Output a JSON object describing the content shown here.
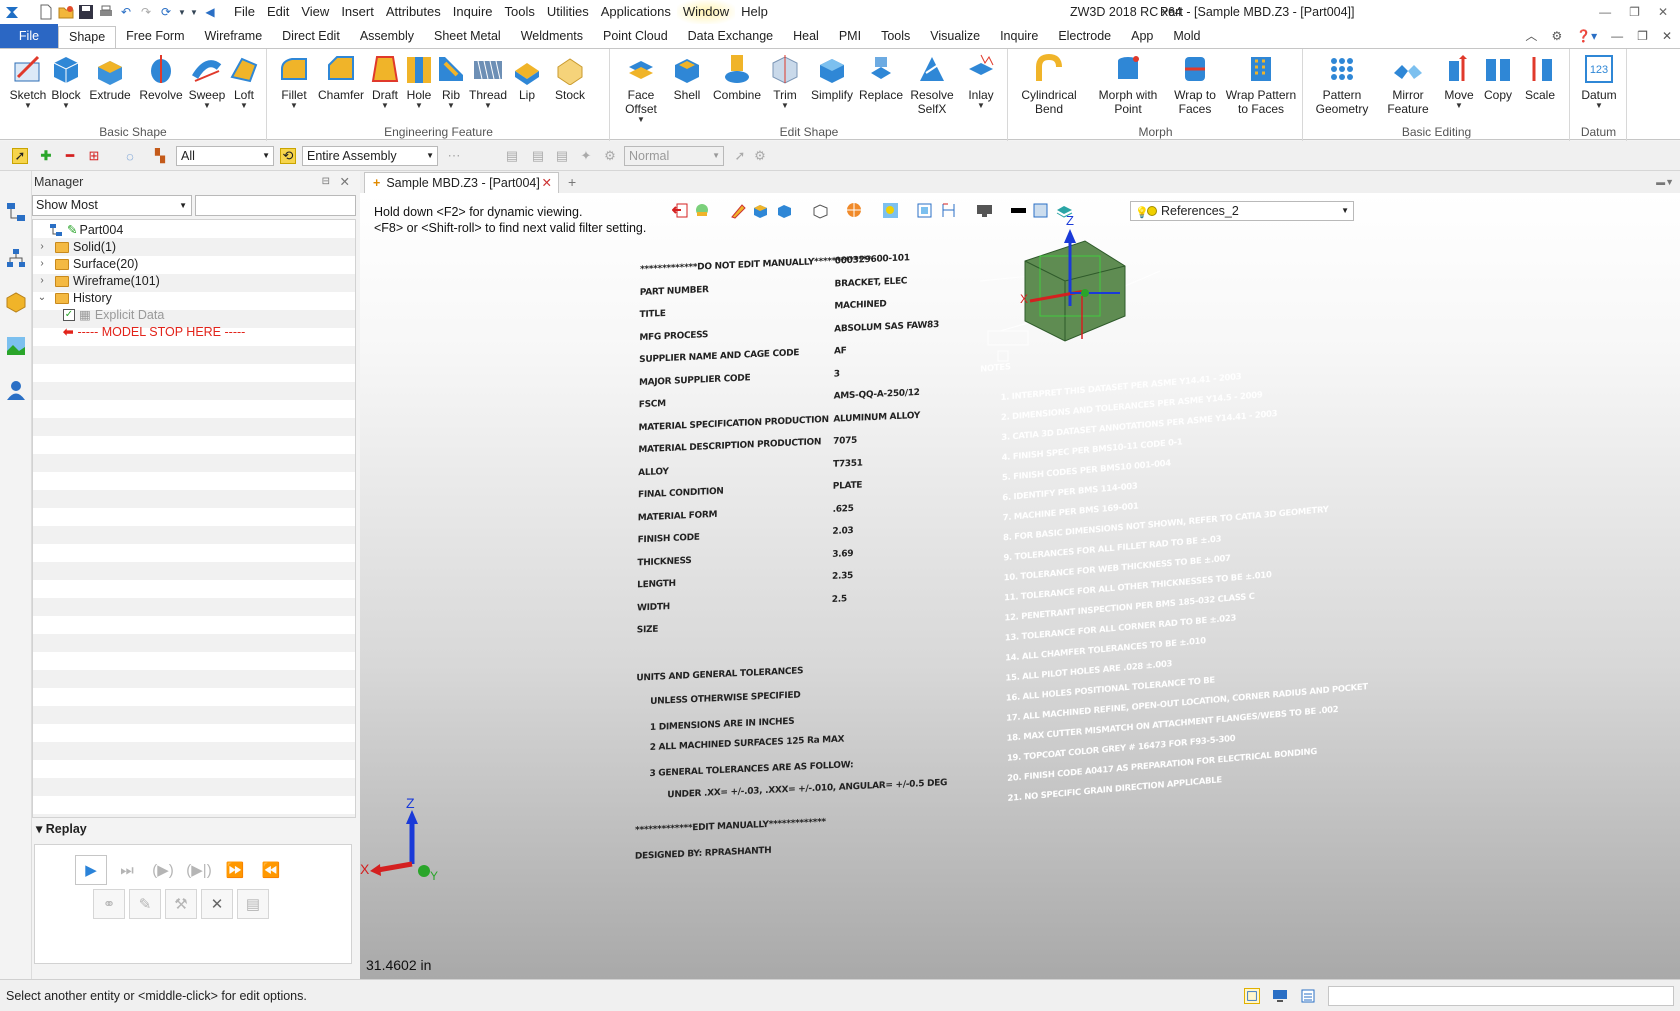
{
  "titlebar": {
    "menus": [
      "File",
      "Edit",
      "View",
      "Insert",
      "Attributes",
      "Inquire",
      "Tools",
      "Utilities",
      "Applications",
      "Window",
      "Help"
    ],
    "app_title": "ZW3D 2018 RC x64",
    "doc_title": "Part - [Sample MBD.Z3 - [Part004]]"
  },
  "ribbon_tabs": [
    "File",
    "Shape",
    "Free Form",
    "Wireframe",
    "Direct Edit",
    "Assembly",
    "Sheet Metal",
    "Weldments",
    "Point Cloud",
    "Data Exchange",
    "Heal",
    "PMI",
    "Tools",
    "Visualize",
    "Inquire",
    "Electrode",
    "App",
    "Mold"
  ],
  "ribbon_groups": {
    "basic_shape": {
      "label": "Basic Shape",
      "buttons": [
        "Sketch",
        "Block",
        "Extrude",
        "Revolve",
        "Sweep",
        "Loft"
      ]
    },
    "engineering_feature": {
      "label": "Engineering Feature",
      "buttons": [
        "Fillet",
        "Chamfer",
        "Draft",
        "Hole",
        "Rib",
        "Thread",
        "Lip",
        "Stock"
      ]
    },
    "edit_shape": {
      "label": "Edit Shape",
      "buttons": [
        "Face Offset",
        "Shell",
        "Combine",
        "Trim",
        "Simplify",
        "Replace",
        "Resolve SelfX",
        "Inlay"
      ]
    },
    "morph": {
      "label": "Morph",
      "buttons": [
        "Cylindrical Bend",
        "Morph with Point",
        "Wrap to Faces",
        "Wrap Pattern to Faces"
      ]
    },
    "basic_editing": {
      "label": "Basic Editing",
      "buttons": [
        "Pattern Geometry",
        "Mirror Feature",
        "Move",
        "Copy",
        "Scale"
      ]
    },
    "datum": {
      "label": "Datum",
      "buttons": [
        "Datum"
      ]
    }
  },
  "toolbar": {
    "filter_value": "All",
    "assembly_value": "Entire Assembly",
    "mode_value": "Normal"
  },
  "manager": {
    "title": "Manager",
    "show_value": "Show Most",
    "tree": [
      {
        "label": "Part004",
        "level": 0
      },
      {
        "label": "Solid(1)",
        "level": 1
      },
      {
        "label": "Surface(20)",
        "level": 1
      },
      {
        "label": "Wireframe(101)",
        "level": 1
      },
      {
        "label": "History",
        "level": 1
      },
      {
        "label": "Explicit Data",
        "level": 2
      },
      {
        "label": "----- MODEL STOP HERE -----",
        "level": 2
      }
    ],
    "replay_label": "Replay"
  },
  "document_tab": "Sample MBD.Z3 - [Part004]",
  "viewport": {
    "hint_1": "Hold down <F2> for dynamic viewing.",
    "hint_2": "<F8> or <Shift-roll> to find next valid filter setting.",
    "references": "References_2",
    "scale_readout": "31.4602 in",
    "triad": {
      "x": "X",
      "y": "Y",
      "z": "Z"
    },
    "table_rows": [
      [
        "*************DO NOT EDIT MANUALLY*************",
        "000329600-101"
      ],
      [
        "PART NUMBER",
        "BRACKET, ELEC"
      ],
      [
        "TITLE",
        "MACHINED"
      ],
      [
        "MFG PROCESS",
        "ABSOLUM SAS FAW83"
      ],
      [
        "SUPPLIER NAME AND CAGE CODE",
        "AF"
      ],
      [
        "MAJOR SUPPLIER CODE",
        "3"
      ],
      [
        "FSCM",
        "AMS-QQ-A-250/12"
      ],
      [
        "MATERIAL SPECIFICATION PRODUCTION",
        "ALUMINUM ALLOY"
      ],
      [
        "MATERIAL DESCRIPTION PRODUCTION",
        "7075"
      ],
      [
        "ALLOY",
        "T7351"
      ],
      [
        "FINAL CONDITION",
        "PLATE"
      ],
      [
        "MATERIAL FORM",
        ".625"
      ],
      [
        "FINISH CODE",
        "2.03"
      ],
      [
        "THICKNESS",
        "3.69"
      ],
      [
        "LENGTH",
        "2.35"
      ],
      [
        "WIDTH",
        "2.5"
      ],
      [
        "SIZE",
        ""
      ]
    ],
    "table_footer": [
      "UNITS AND GENERAL TOLERANCES",
      "UNLESS OTHERWISE SPECIFIED",
      "1    DIMENSIONS ARE IN INCHES",
      "2    ALL MACHINED SURFACES 125 Ra MAX",
      "3  GENERAL TOLERANCES ARE AS FOLLOW:",
      "UNDER .XX= +/-.03, .XXX= +/-.010, ANGULAR= +/-0.5 DEG",
      "*************EDIT MANUALLY*************",
      "DESIGNED BY: RPRASHANTH"
    ],
    "notes_title": "NOTES",
    "notes": [
      "1. INTERPRET THIS DATASET PER ASME Y14.41 - 2003",
      "2. DIMENSIONS AND TOLERANCES PER ASME Y14.5 - 2009",
      "3. CATIA 3D DATASET ANNOTATIONS PER ASME Y14.41 - 2003",
      "4. FINISH SPEC PER BMS10-11 CODE 0-1",
      "5. FINISH CODES PER BMS10 001-004",
      "6. IDENTIFY PER BMS 114-003",
      "7. MACHINE PER BMS 169-001",
      "8. FOR BASIC DIMENSIONS NOT SHOWN, REFER TO CATIA 3D GEOMETRY",
      "9. TOLERANCES FOR ALL FILLET RAD TO BE ±.03",
      "10. TOLERANCE FOR WEB THICKNESS TO BE ±.007",
      "11. TOLERANCE FOR ALL OTHER THICKNESSES TO BE ±.010",
      "12. PENETRANT INSPECTION PER BMS 185-032 CLASS C",
      "13. TOLERANCE FOR ALL CORNER RAD TO BE ±.023",
      "14. ALL CHAMFER TOLERANCES TO BE ±.010",
      "15. ALL PILOT HOLES ARE .028 ±.003",
      "16. ALL HOLES POSITIONAL TOLERANCE TO BE",
      "17. ALL MACHINED REFINE, OPEN-OUT LOCATION, CORNER RADIUS AND POCKET",
      "18. MAX CUTTER MISMATCH ON ATTACHMENT FLANGES/WEBS TO BE .002",
      "19. TOPCOAT COLOR GREY # 16473 FOR F93-5-300",
      "20. FINISH CODE A0417 AS PREPARATION FOR ELECTRICAL BONDING",
      "21. NO SPECIFIC GRAIN DIRECTION APPLICABLE"
    ]
  },
  "status": {
    "message": "Select another entity or <middle-click> for edit options."
  }
}
